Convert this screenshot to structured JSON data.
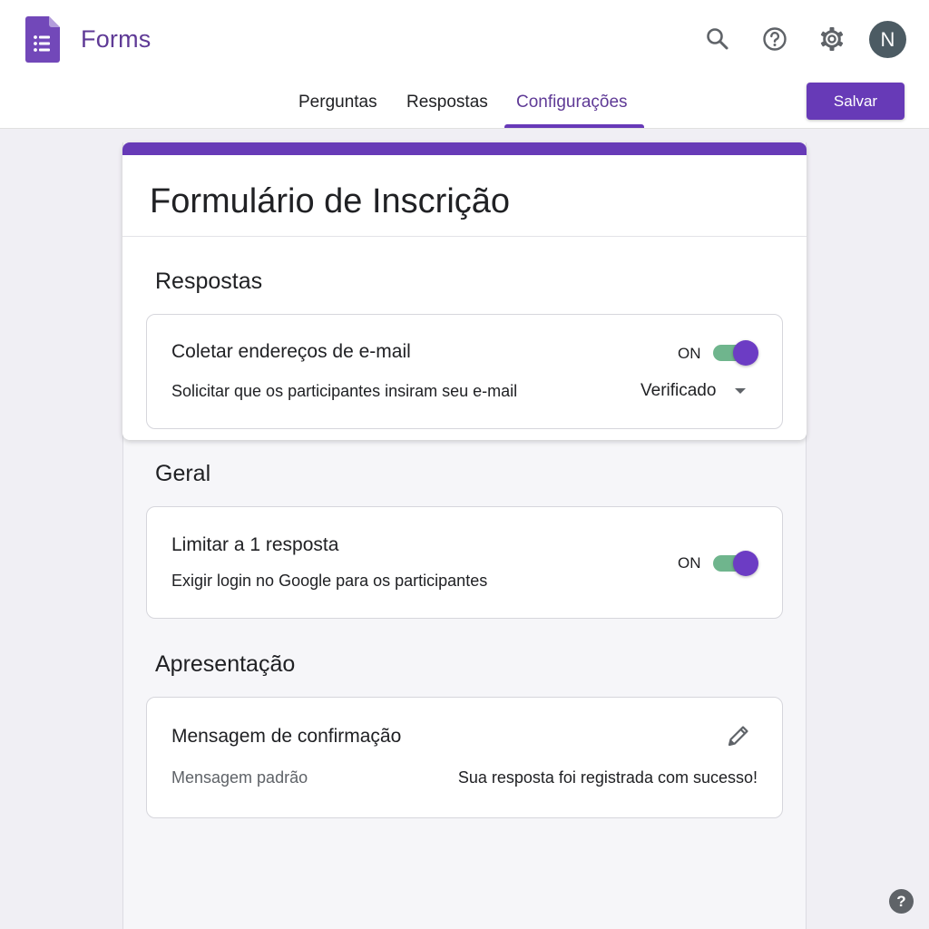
{
  "app": {
    "name": "Forms"
  },
  "header": {
    "icons": [
      "search-icon",
      "help-icon",
      "gear-icon"
    ],
    "avatar_initial": "N",
    "save_label": "Salvar"
  },
  "tabs": [
    {
      "label": "Perguntas",
      "active": false
    },
    {
      "label": "Respostas",
      "active": false
    },
    {
      "label": "Configurações",
      "active": true
    }
  ],
  "form": {
    "title": "Formulário de Inscrição"
  },
  "sections": {
    "responses": {
      "title": "Respostas",
      "collect_email": {
        "title": "Coletar endereços de e-mail",
        "description": "Solicitar que os participantes insiram seu e-mail",
        "state_label": "ON",
        "enabled": true,
        "dropdown_value": "Verificado"
      }
    },
    "general": {
      "title": "Geral",
      "limit_one": {
        "title": "Limitar a 1 resposta",
        "description": "Exigir login no Google para os participantes",
        "state_label": "ON",
        "enabled": true
      }
    },
    "presentation": {
      "title": "Apresentação",
      "confirmation": {
        "title": "Mensagem de confirmação",
        "label": "Mensagem padrão",
        "value": "Sua resposta foi registrada com sucesso!"
      }
    }
  },
  "help_fab": "?",
  "colors": {
    "brand": "#673ab7",
    "toggle_track": "#6fb58d",
    "avatar_bg": "#4c5b63"
  }
}
